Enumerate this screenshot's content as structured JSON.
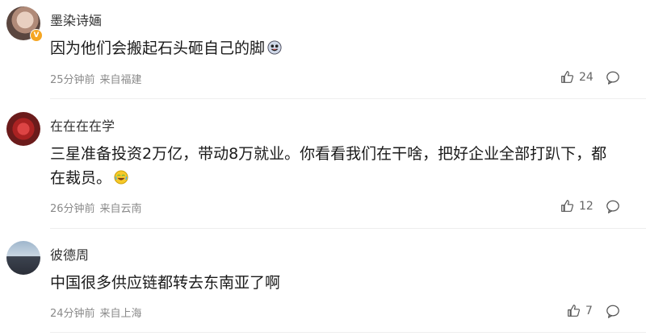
{
  "comments": [
    {
      "username": "墨染诗婳",
      "text": "因为他们会搬起石头砸自己的脚",
      "time": "25分钟前",
      "location": "来自福建",
      "likes": "24",
      "verified_badge": "V"
    },
    {
      "username": "在在在在学",
      "text": "三星准备投资2万亿，带动8万就业。你看看我们在干啥，把好企业全部打趴下，都在裁员。",
      "time": "26分钟前",
      "location": "来自云南",
      "likes": "12"
    },
    {
      "username": "彼德周",
      "text": "中国很多供应链都转去东南亚了啊",
      "time": "24分钟前",
      "location": "来自上海",
      "likes": "7"
    }
  ],
  "icons": {
    "like": "thumbs-up-icon",
    "reply": "comment-bubble-icon"
  },
  "colors": {
    "text": "#1a1a1a",
    "meta": "#8a8a8a",
    "badge": "#f5a623"
  }
}
